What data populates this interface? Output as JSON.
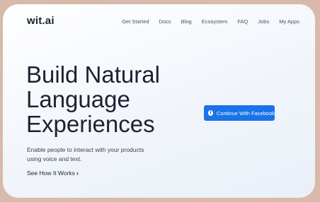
{
  "header": {
    "logo": "wit.ai",
    "nav": [
      "Get Started",
      "Docs",
      "Blog",
      "Ecosystem",
      "FAQ",
      "Jobs",
      "My Apps"
    ]
  },
  "hero": {
    "headline": [
      "Build Natural",
      "Language",
      "Experiences"
    ],
    "subtext": "Enable people to interact with your products using voice and text.",
    "link_label": "See How It Works",
    "link_icon": "chevron-right-icon"
  },
  "cta": {
    "label": "Continue With Facebook",
    "icon": "facebook-icon",
    "color": "#1a73e8"
  }
}
